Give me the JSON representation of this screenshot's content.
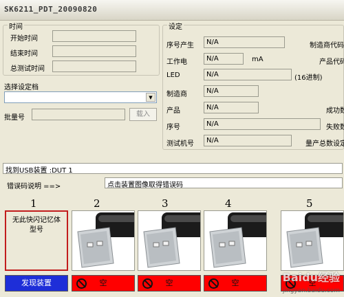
{
  "window": {
    "title": "SK6211_PDT_20090820"
  },
  "time_group": {
    "title": "时间",
    "start_label": "开始时间",
    "end_label": "结束时间",
    "total_label": "总测试时间",
    "start_value": "",
    "end_value": "",
    "total_value": ""
  },
  "profile": {
    "label": "选择设定档",
    "selected": "",
    "batch_label": "批量号",
    "batch_value": "",
    "load_button": "载入"
  },
  "settings_group": {
    "title": "设定",
    "rows": [
      {
        "label": "序号产生",
        "value": "N/A",
        "suffix": "",
        "right_label": "制造商代码"
      },
      {
        "label": "工作电",
        "value": "N/A",
        "suffix": "mA",
        "right_label": "产品代码"
      },
      {
        "label": "LED",
        "value": "N/A",
        "suffix": "(16进制)",
        "right_label": ""
      },
      {
        "label": "制造商",
        "value": "N/A",
        "suffix": "",
        "right_label": ""
      },
      {
        "label": "产品",
        "value": "N/A",
        "suffix": "",
        "right_label": "成功数"
      },
      {
        "label": "序号",
        "value": "N/A",
        "suffix": "",
        "right_label": "失败数"
      },
      {
        "label": "测试机号",
        "value": "N/A",
        "suffix": "",
        "right_label": "量产总数设定"
      }
    ]
  },
  "status": {
    "found_text": "找到USB装置 :DUT 1",
    "error_label": "错误码说明 ==>",
    "error_text": "点击装置图像取得错误码"
  },
  "slots": [
    {
      "number": "1",
      "text": "无此快闪记忆体型号",
      "button": "发现装置",
      "button_color": "#1e2ed8"
    },
    {
      "number": "2",
      "text": "",
      "button": "空",
      "button_color": "#ff0000"
    },
    {
      "number": "3",
      "text": "",
      "button": "空",
      "button_color": "#ff0000"
    },
    {
      "number": "4",
      "text": "",
      "button": "空",
      "button_color": "#ff0000"
    },
    {
      "number": "5",
      "text": "",
      "button": "空",
      "button_color": "#ff0000"
    }
  ],
  "watermark": {
    "brand": "Baidu经验",
    "url": "jingyan.baidu.com"
  }
}
